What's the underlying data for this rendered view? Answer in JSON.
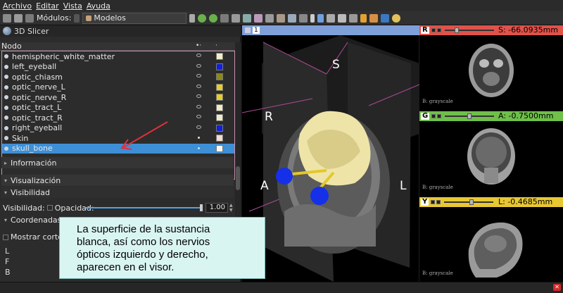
{
  "menu": [
    "Archivo",
    "Editar",
    "Vista",
    "Ayuda"
  ],
  "toolbar": {
    "modules_label": "Módulos:",
    "module_name": "Modelos"
  },
  "app_title": "3D Slicer",
  "tree": {
    "column_header": "Nodo",
    "rows": [
      {
        "name": "hemispheric_white_matter",
        "color": "#f4eec8"
      },
      {
        "name": "left_eyeball",
        "color": "#1020e0"
      },
      {
        "name": "optic_chiasm",
        "color": "#8a8a1a"
      },
      {
        "name": "optic_nerve_L",
        "color": "#e6cf2a"
      },
      {
        "name": "optic_nerve_R",
        "color": "#e6cf2a"
      },
      {
        "name": "optic_tract_L",
        "color": "#f0ecc8"
      },
      {
        "name": "optic_tract_R",
        "color": "#f0ecc8"
      },
      {
        "name": "right_eyeball",
        "color": "#1020e0"
      },
      {
        "name": "Skin",
        "color": "#f3dcd0"
      },
      {
        "name": "skull_bone",
        "color": "#f7f7f0"
      }
    ]
  },
  "sections": {
    "informacion": "Información",
    "visualizacion": "Visualización",
    "visibilidad_group": "Visibilidad",
    "visibilidad_label": "Visibilidad:",
    "opacidad_label": "Opacidad:",
    "opacidad_value": "1.00",
    "coordenadas": "Coordenadas:",
    "mostrar_corte": "Mostrar corte",
    "lfb": [
      "L",
      "F",
      "B"
    ]
  },
  "callout": {
    "line1": "La superficie de la sustancia",
    "line2": "blanca, así como los nervios",
    "line3": "ópticos izquierdo y derecho,",
    "line4": "aparecen en el visor."
  },
  "view3d": {
    "number": "1",
    "orientation": {
      "top": "S",
      "left": "R",
      "anterior": "A",
      "right": "L"
    }
  },
  "slices": [
    {
      "letter": "R",
      "color": "#e0524a",
      "value": "S: -66.0935mm",
      "layer": "B: grayscale"
    },
    {
      "letter": "G",
      "color": "#6fbf4a",
      "value": "A: -0.7500mm",
      "layer": "B: grayscale"
    },
    {
      "letter": "Y",
      "color": "#e7c833",
      "value": "L: -0.4685mm",
      "layer": "B: grayscale"
    }
  ],
  "colors": {
    "selected_row": "#3d8fd6",
    "view3d_header": "#7f9fd8",
    "callout_bg": "#d9f5f2"
  }
}
